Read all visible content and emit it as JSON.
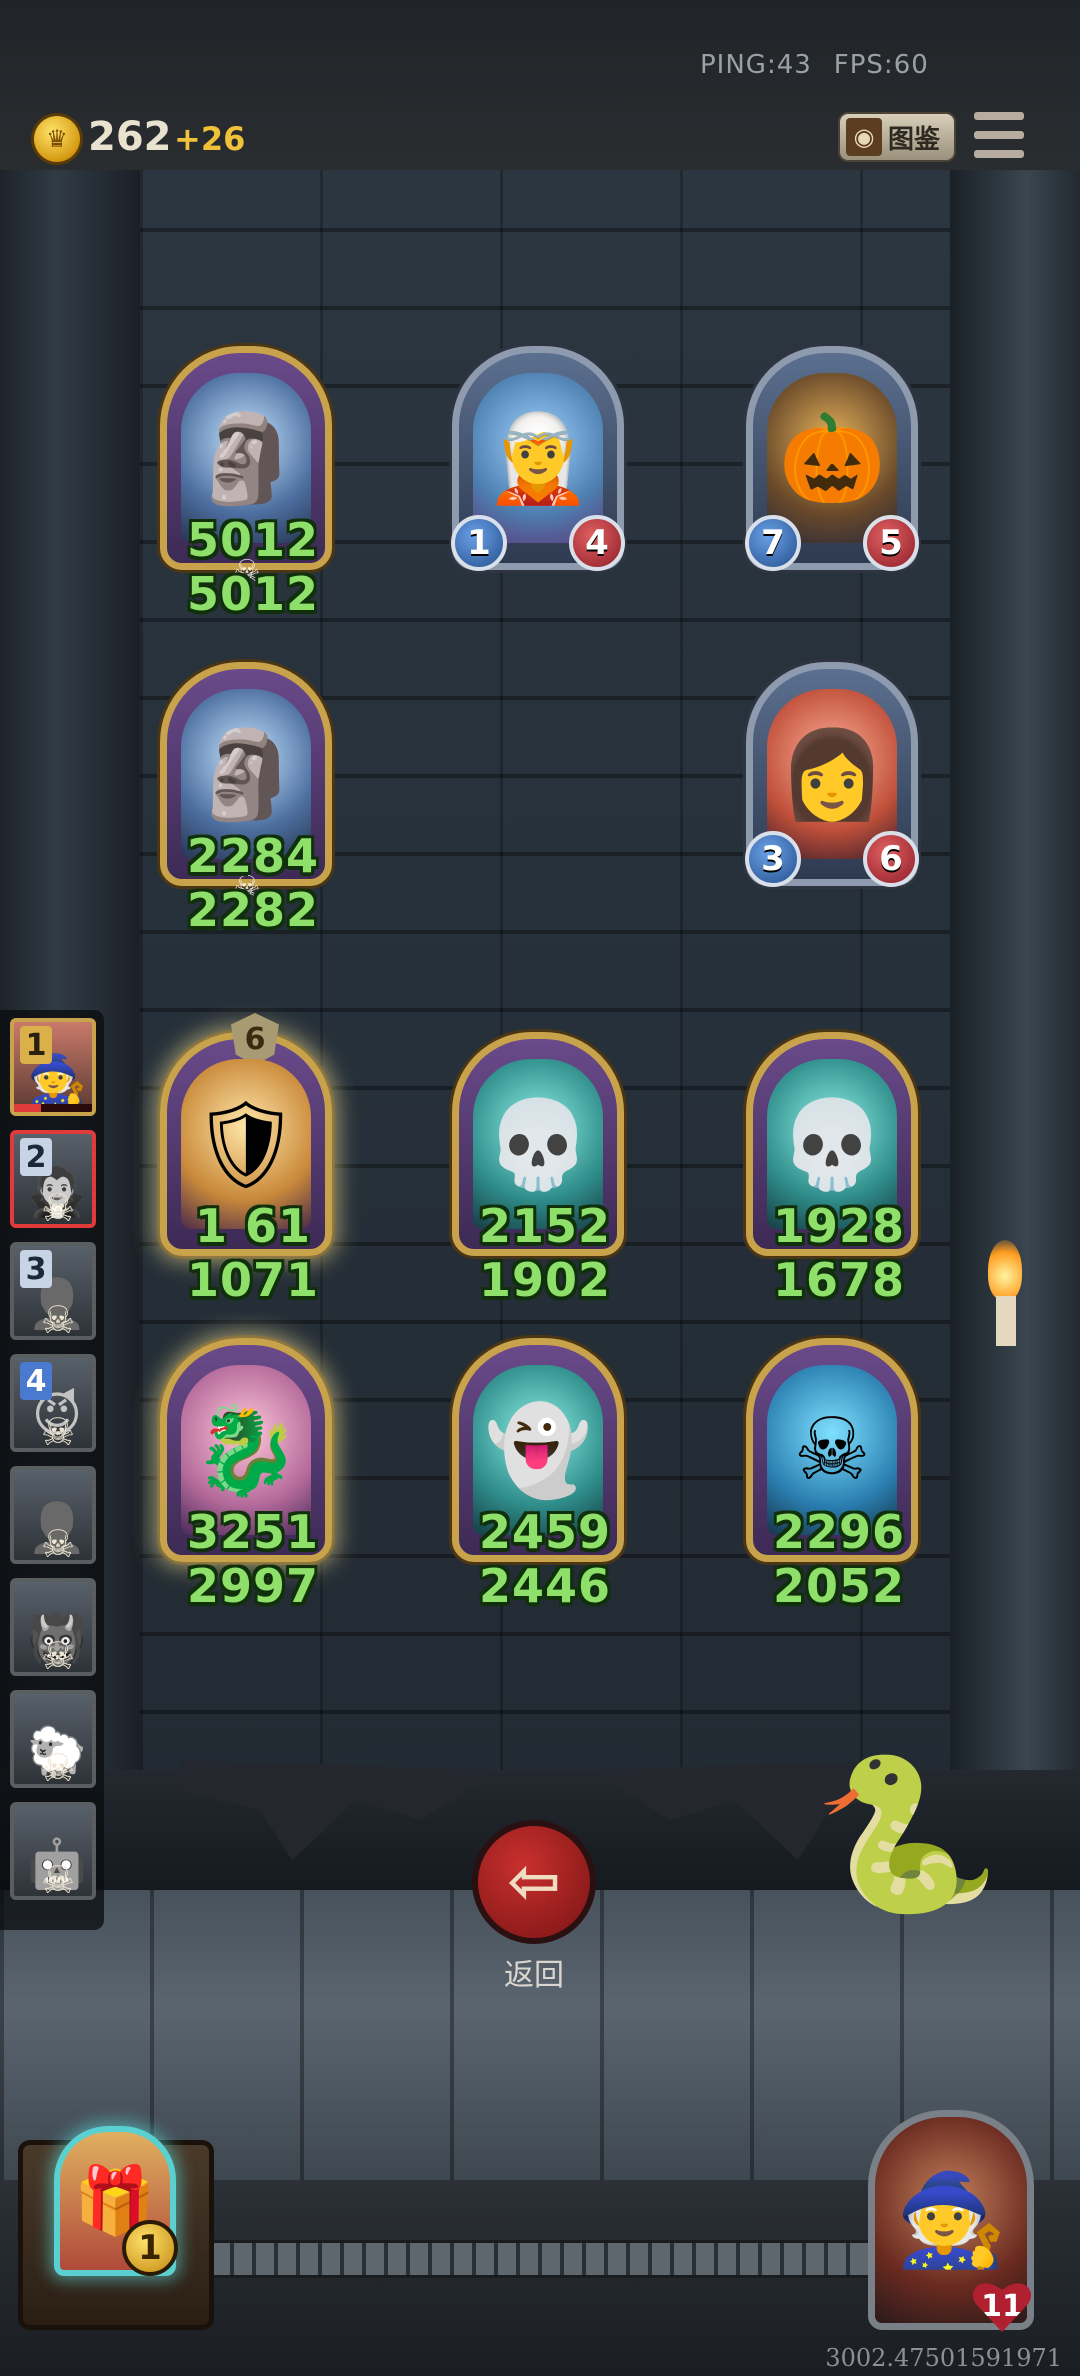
{
  "hud": {
    "ping": "PING:43",
    "fps": "FPS:60",
    "gold": "262",
    "gold_income": "+26",
    "codex_label": "图鉴",
    "menu_icon": "hamburger-menu-icon"
  },
  "board": {
    "enemy_row_1": [
      {
        "name": "ice-gargoyle",
        "atk": "5012",
        "hp": "5012",
        "display": "stat",
        "frame": "gold",
        "icon": "gargoyle"
      },
      {
        "name": "blue-elf-mage",
        "atk": "1",
        "hp": "4",
        "display": "badge",
        "frame": "silver",
        "icon": "elf"
      },
      {
        "name": "pumpkin-lock-golem",
        "atk": "7",
        "hp": "5",
        "display": "badge",
        "frame": "silver",
        "icon": "pumpkin"
      }
    ],
    "enemy_row_2": [
      {
        "name": "ice-gargoyle",
        "atk": "2284",
        "hp": "2282",
        "display": "stat",
        "frame": "gold",
        "icon": "gargoyle"
      },
      {
        "name": "red-haired-priestess",
        "atk": "3",
        "hp": "6",
        "display": "badge",
        "frame": "silver",
        "icon": "priestess"
      }
    ],
    "player_row_1": [
      {
        "name": "golden-paladin",
        "atk": "1 61",
        "hp": "1071",
        "tier": "6",
        "display": "stat",
        "frame": "gold",
        "icon": "paladin"
      },
      {
        "name": "ghost-ghoul",
        "atk": "2152",
        "hp": "1902",
        "display": "stat",
        "frame": "gold",
        "icon": "ghoul"
      },
      {
        "name": "ghost-ghoul",
        "atk": "1928",
        "hp": "1678",
        "display": "stat",
        "frame": "gold",
        "icon": "ghoul"
      }
    ],
    "player_row_2": [
      {
        "name": "pink-dragon",
        "atk": "3251",
        "hp": "2997",
        "display": "stat",
        "frame": "gold",
        "icon": "dragon"
      },
      {
        "name": "spectral-vampire",
        "atk": "2459",
        "hp": "2446",
        "display": "stat",
        "frame": "gold",
        "icon": "vampire"
      },
      {
        "name": "hooded-reaper",
        "atk": "2296",
        "hp": "2052",
        "display": "stat",
        "frame": "gold",
        "icon": "reaper"
      }
    ]
  },
  "queue": [
    {
      "label": "1",
      "state": "active",
      "hp_fraction": 0.35
    },
    {
      "label": "2",
      "state": "selected"
    },
    {
      "label": "3",
      "state": "dead"
    },
    {
      "label": "4",
      "state": "dead"
    },
    {
      "label": "",
      "state": "dead"
    },
    {
      "label": "",
      "state": "dead"
    },
    {
      "label": "",
      "state": "dead"
    },
    {
      "label": "",
      "state": "dead"
    }
  ],
  "bottom": {
    "back_label": "返回",
    "shop_level": "1",
    "hero_hp": "11",
    "coordinate_readout": "3002.47501591971"
  },
  "colors": {
    "stat_text": "#8ee06a",
    "gold_frame": "#c9a24c",
    "back_button": "#b02828"
  }
}
